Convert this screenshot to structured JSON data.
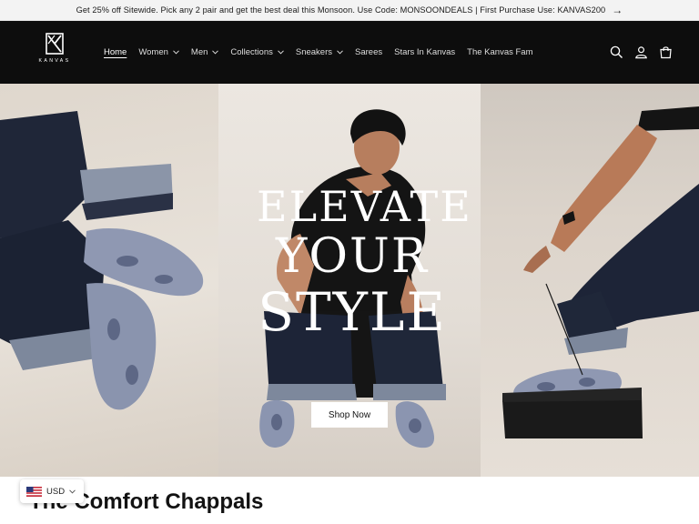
{
  "announcement": {
    "text": "Get 25% off Sitewide. Pick any 2 pair and get the best deal this Monsoon. Use Code: MONSOONDEALS | First Purchase Use: KANVAS200",
    "arrow_icon": "arrow-right-icon"
  },
  "header": {
    "logo_text": "KANVAS",
    "nav": [
      {
        "label": "Home",
        "active": true,
        "dropdown": false
      },
      {
        "label": "Women",
        "active": false,
        "dropdown": true
      },
      {
        "label": "Men",
        "active": false,
        "dropdown": true
      },
      {
        "label": "Collections",
        "active": false,
        "dropdown": true
      },
      {
        "label": "Sneakers",
        "active": false,
        "dropdown": true
      },
      {
        "label": "Sarees",
        "active": false,
        "dropdown": false
      },
      {
        "label": "Stars In Kanvas",
        "active": false,
        "dropdown": false
      },
      {
        "label": "The Kanvas Fam",
        "active": false,
        "dropdown": false
      }
    ],
    "icons": [
      "search-icon",
      "account-icon",
      "cart-icon"
    ]
  },
  "hero": {
    "headline_1": "ELEVATE",
    "headline_2": "YOUR",
    "headline_3": "STYLE",
    "cta_label": "Shop Now"
  },
  "section": {
    "title": "The Comfort Chappals"
  },
  "currency": {
    "code": "USD"
  },
  "colors": {
    "header_bg": "#0d0d0d",
    "announcement_bg": "#f3f3f3",
    "denim": "#1f2638",
    "shoe_print": "#8f98b2"
  }
}
